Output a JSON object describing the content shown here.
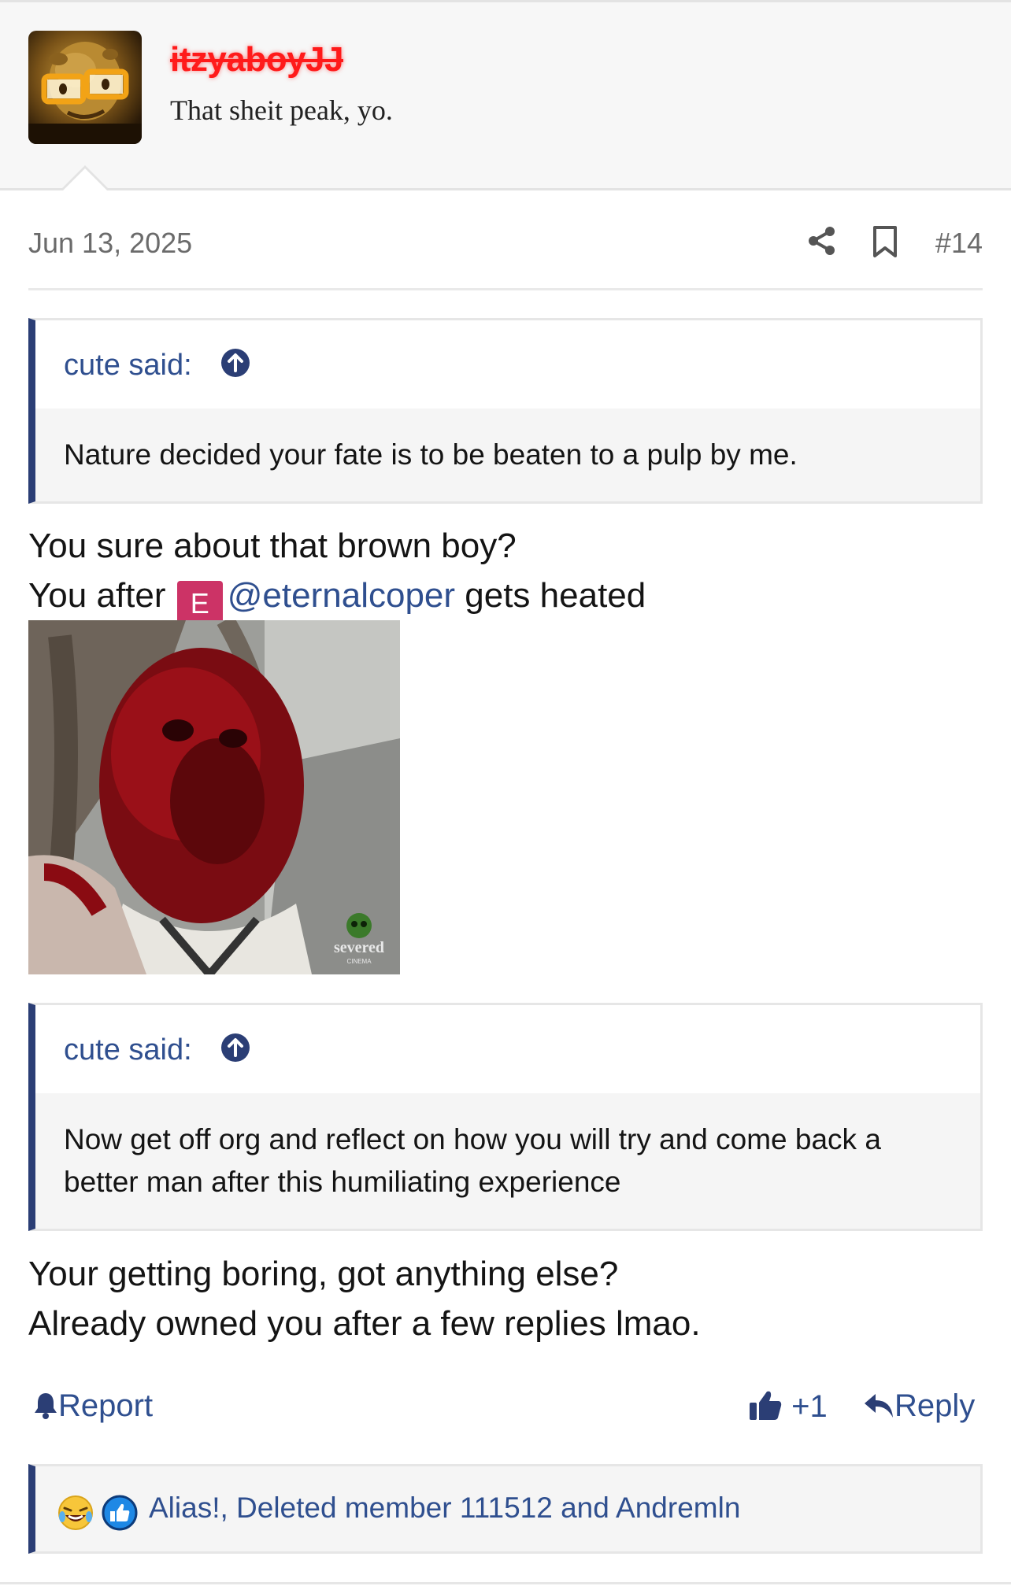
{
  "post": {
    "username": "itzyaboyJJ",
    "user_title": "That sheit peak, yo.",
    "date": "Jun 13, 2025",
    "post_number": "#14"
  },
  "quote1": {
    "author": "cute said:",
    "text": "Nature decided your fate is to be beaten to a pulp by me."
  },
  "body1": {
    "line1": "You sure about that brown boy?",
    "line2_prefix": "You after",
    "mention_initial": "E",
    "mention": "@eternalcoper",
    "line2_suffix": "gets heated"
  },
  "image": {
    "watermark": "severed",
    "watermark_sub": "CINEMA"
  },
  "quote2": {
    "author": "cute said:",
    "text": "Now get off org and reflect on how you will try and come back a better man after this humiliating experience"
  },
  "body2": {
    "line1": "Your getting boring, got anything else?",
    "line2": "Already owned you after a few replies lmao."
  },
  "actions": {
    "report": "Report",
    "like_count": "+1",
    "reply": "Reply"
  },
  "reactions": {
    "text": "Alias!, Deleted member 111512 and Andremln"
  },
  "colors": {
    "accent": "#2b3e75",
    "link": "#2f4f8f",
    "username": "#ff1a1a",
    "mention_badge": "#cc3366"
  }
}
